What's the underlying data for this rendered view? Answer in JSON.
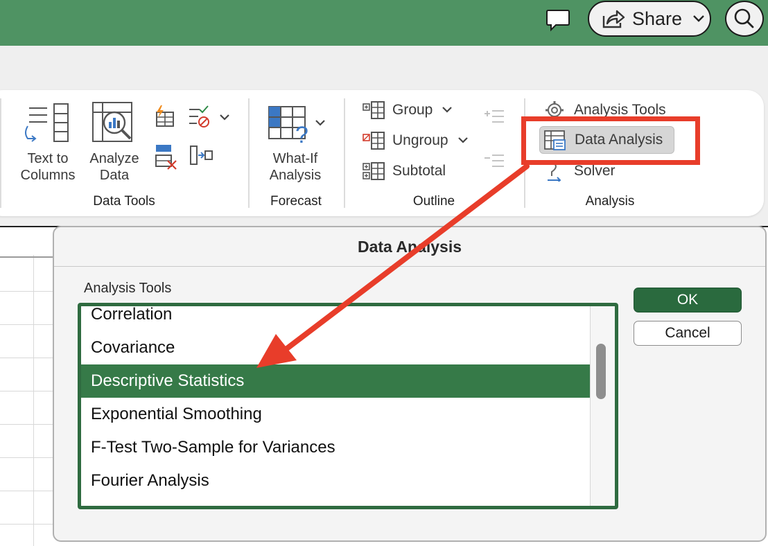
{
  "colors": {
    "title_bar": "#4f9363",
    "accent_green": "#367a48",
    "annotation_red": "#e83d2a"
  },
  "header": {
    "share_label": "Share",
    "icons": [
      "comment-icon",
      "share-icon",
      "chevron-down-icon",
      "search-icon"
    ]
  },
  "ribbon": {
    "data_tools": {
      "group_label": "Data Tools",
      "text_to_columns": [
        "Text to",
        "Columns"
      ],
      "analyze_data": [
        "Analyze",
        "Data"
      ]
    },
    "forecast": {
      "group_label": "Forecast",
      "what_if": [
        "What-If",
        "Analysis"
      ]
    },
    "outline": {
      "group_label": "Outline",
      "group": "Group",
      "ungroup": "Ungroup",
      "subtotal": "Subtotal"
    },
    "analysis": {
      "group_label": "Analysis",
      "analysis_tools": "Analysis Tools",
      "data_analysis": "Data Analysis",
      "solver": "Solver"
    }
  },
  "dialog": {
    "title": "Data Analysis",
    "section_label": "Analysis Tools",
    "items": [
      "Correlation",
      "Covariance",
      "Descriptive Statistics",
      "Exponential Smoothing",
      "F-Test Two-Sample for Variances",
      "Fourier Analysis"
    ],
    "selected": "Descriptive Statistics",
    "ok_label": "OK",
    "cancel_label": "Cancel"
  }
}
